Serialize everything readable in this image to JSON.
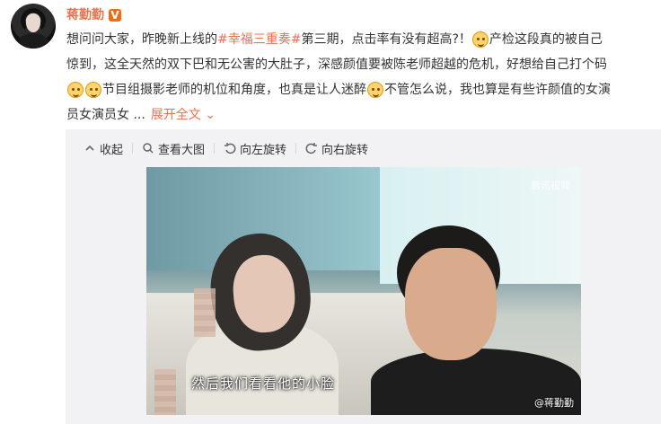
{
  "author": {
    "name": "蒋勤勤",
    "verified_badge": "V"
  },
  "post": {
    "line1_before": "想问问大家，昨晚新上线的",
    "hashtag": "#幸福三重奏#",
    "line1_after": "第三期，点击率有没有超高?！",
    "line1_tail": "产检这段真的被自己",
    "line2": "惊到，这全天然的双下巴和无公害的大肚子，深感颜值要被陈老师超越的危机，好想给自己打个码",
    "line3_after_emojis": "节目组摄影老师的机位和角度，也真是让人迷醉",
    "line3_tail": "不管怎么说，我也算是有些许颜值的女演",
    "line4": "员女演员女 ...",
    "expand_label": "展开全文"
  },
  "toolbar": {
    "collapse": "收起",
    "view_large": "查看大图",
    "rotate_left": "向左旋转",
    "rotate_right": "向右旋转"
  },
  "image": {
    "subtitle": "然后我们看看他的小脸",
    "watermark_top": "腾讯视频",
    "watermark_bottom": "@蒋勤勤"
  }
}
